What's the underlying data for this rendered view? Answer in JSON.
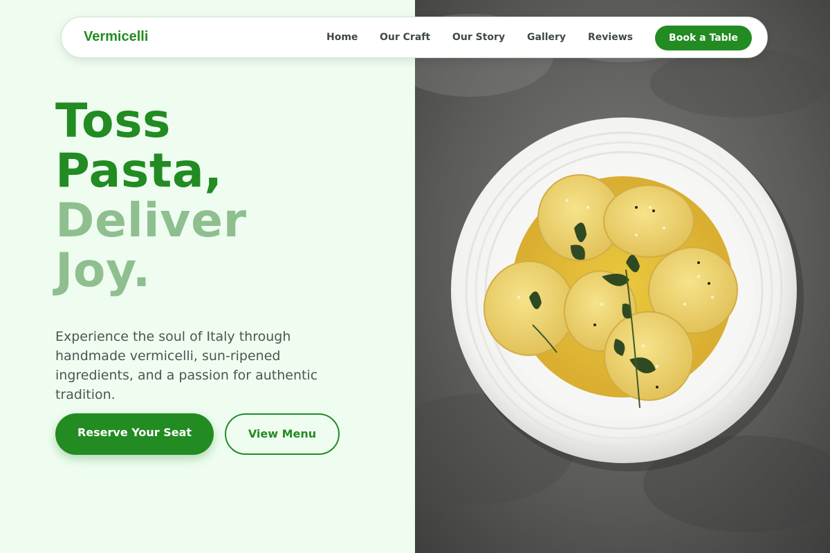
{
  "brand": {
    "name": "Vermicelli"
  },
  "nav": {
    "links": [
      "Home",
      "Our Craft",
      "Our Story",
      "Gallery",
      "Reviews"
    ],
    "cta_label": "Book a Table"
  },
  "hero": {
    "headline": {
      "line1": "Toss",
      "line2": "Pasta,",
      "line3": "Deliver",
      "line4": "Joy."
    },
    "description": "Experience the soul of Italy through handmade vermicelli, sun-ripened ingredients, and a passion for authentic tradition.",
    "primary_button": "Reserve Your Seat",
    "secondary_button": "View Menu",
    "image_icon": "ravioli-plate-photo"
  },
  "colors": {
    "accent": "#228b22",
    "accent_soft": "#8fbf8f",
    "left_background": "#effdf1",
    "body_text": "#4a5550"
  }
}
